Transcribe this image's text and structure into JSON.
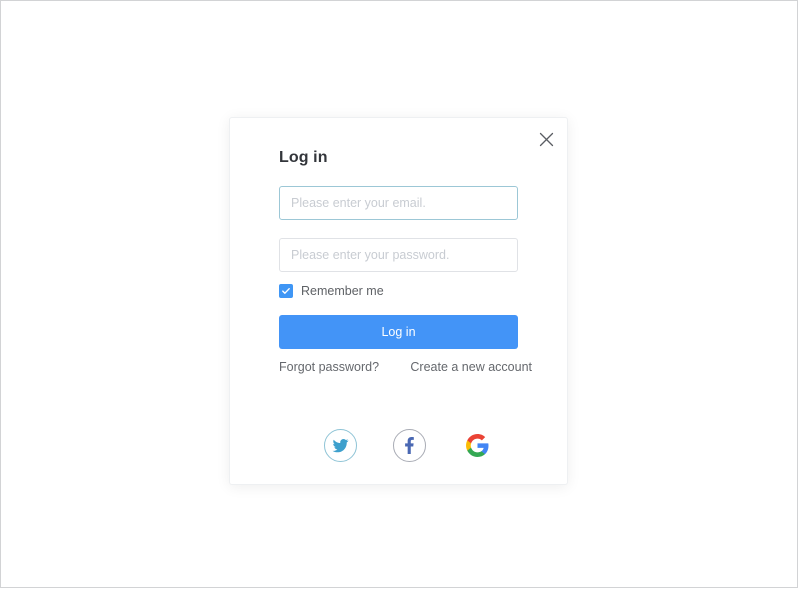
{
  "modal": {
    "title": "Log in",
    "close_icon": "close-icon",
    "email": {
      "placeholder": "Please enter your email.",
      "value": "",
      "focused": true,
      "border_color": "#9cc7d6"
    },
    "password": {
      "placeholder": "Please enter your password.",
      "value": "",
      "focused": false,
      "border_color": "#e0e2e6"
    },
    "remember": {
      "label": "Remember me",
      "checked": true,
      "accent_color": "#3f96f5"
    },
    "submit": {
      "label": "Log in",
      "background": "#4394f7",
      "text_color": "#ffffff"
    },
    "links": [
      {
        "label": "Forgot password?",
        "name": "forgot-password-link"
      },
      {
        "label": "Create a new account",
        "name": "create-account-link"
      }
    ],
    "social": [
      {
        "name": "twitter-icon",
        "label": "Twitter",
        "color": "#3ea0cd",
        "ring": "#8fc4d6"
      },
      {
        "name": "facebook-icon",
        "label": "Facebook",
        "color": "#4a68b3",
        "ring": "#a9acb5"
      },
      {
        "name": "google-icon",
        "label": "Google",
        "color": "#4285f4",
        "ring": "none"
      }
    ]
  },
  "colors": {
    "page_background": "#ffffff",
    "page_border": "#d2d3d5",
    "modal_background": "#ffffff",
    "title_text": "#33363b",
    "placeholder_text": "#c8ccd2",
    "link_text": "#65686d",
    "google_red": "#ea4335",
    "google_yellow": "#fbbc05",
    "google_green": "#34a853",
    "google_blue": "#4285f4"
  }
}
